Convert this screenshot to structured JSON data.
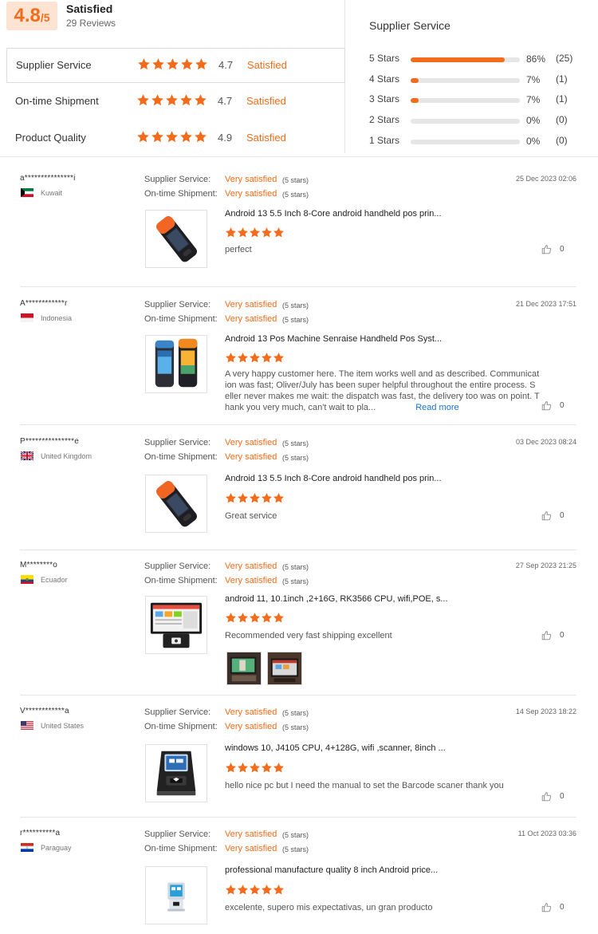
{
  "summary": {
    "score": "4.8",
    "score_suffix": "/5",
    "title": "Satisfied",
    "reviews": "29 Reviews",
    "ratings": [
      {
        "label": "Supplier Service",
        "value": "4.7",
        "word": "Satisfied",
        "stars": 5
      },
      {
        "label": "On-time Shipment",
        "value": "4.7",
        "word": "Satisfied",
        "stars": 5
      },
      {
        "label": "Product Quality",
        "value": "4.9",
        "word": "Satisfied",
        "stars": 5
      }
    ]
  },
  "distribution": {
    "title": "Supplier Service",
    "rows": [
      {
        "label": "5 Stars",
        "fraction": 0.86,
        "pct": "86%",
        "count": "(25)"
      },
      {
        "label": "4 Stars",
        "fraction": 0.07,
        "pct": "7%",
        "count": "(1)"
      },
      {
        "label": "3 Stars",
        "fraction": 0.07,
        "pct": "7%",
        "count": "(1)"
      },
      {
        "label": "2 Stars",
        "fraction": 0,
        "pct": "0%",
        "count": "(0)"
      },
      {
        "label": "1 Stars",
        "fraction": 0,
        "pct": "0%",
        "count": "(0)"
      }
    ]
  },
  "labels": {
    "supplier_service": "Supplier Service:",
    "ontime_shipment": "On-time Shipment:",
    "very_satisfied": "Very satisfied",
    "five_stars": "(5 stars)",
    "read_more": "Read more"
  },
  "colors": {
    "accent": "#f26c1b",
    "star": "#f26c1b",
    "bar_track": "#e6e6e6",
    "link": "#1a73c9"
  },
  "reviews": [
    {
      "user": "a***************i",
      "country": "Kuwait",
      "flag": "kuwait-flag-icon",
      "date": "25 Dec 2023 02:06",
      "product": "Android 13 5.5 Inch 8-Core android handheld pos prin...",
      "product_image": "handheld-pos-orange-icon",
      "stars": 5,
      "text": "perfect",
      "likes": "0"
    },
    {
      "user": "A************r",
      "country": "Indonesia",
      "flag": "indonesia-flag-icon",
      "date": "21 Dec 2023 17:51",
      "product": "Android 13 Pos Machine Senraise Handheld Pos Syst...",
      "product_image": "handheld-pos-pair-icon",
      "stars": 5,
      "text": "A very happy customer here. The item works well and as described. Communication was fast; Oliver/July has been super helpful throughout the entire process. Seller never makes me wait: the dispatch was fast, the delivery too was on point. Thank you very much, can't wait to pla...",
      "likes": "0",
      "read_more": true
    },
    {
      "user": "P***************e",
      "country": "United Kingdom",
      "flag": "uk-flag-icon",
      "date": "03 Dec 2023 08:24",
      "product": "Android 13 5.5 Inch 8-Core android handheld pos prin...",
      "product_image": "handheld-pos-orange-icon",
      "stars": 5,
      "text": "Great service",
      "likes": "0"
    },
    {
      "user": "M********o",
      "country": "Ecuador",
      "flag": "ecuador-flag-icon",
      "date": "27 Sep 2023 21:25",
      "product": "android 11, 10.1inch ,2+16G, RK3566 CPU, wifi,POE, s...",
      "product_image": "tablet-pos-terminal-icon",
      "stars": 5,
      "text": "Recommended very fast shipping excellent",
      "likes": "0",
      "photos": [
        "customer-photo-1",
        "customer-photo-2"
      ]
    },
    {
      "user": "V************a",
      "country": "United States",
      "flag": "us-flag-icon",
      "date": "14 Sep 2023 18:22",
      "product": "windows 10, J4105 CPU, 4+128G, wifi ,scanner, 8inch ...",
      "product_image": "desktop-pos-scanner-icon",
      "stars": 5,
      "text": "hello nice pc but I need the manual to set the Barcode scaner thank you",
      "likes": "0"
    },
    {
      "user": "r**********a",
      "country": "Paraguay",
      "flag": "paraguay-flag-icon",
      "date": "11 Oct 2023 03:36",
      "product": "professional manufacture quality 8 inch Android price...",
      "product_image": "kiosk-pos-icon",
      "stars": 5,
      "text": "excelente, supero mis expectativas, un gran producto",
      "likes": "0"
    }
  ]
}
